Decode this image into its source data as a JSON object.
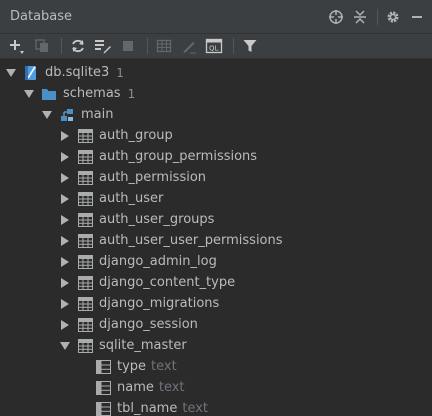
{
  "panel": {
    "title": "Database"
  },
  "title_tools": [
    {
      "name": "crosshair-icon"
    },
    {
      "name": "collapse-icon"
    },
    {
      "name": "gear-icon"
    },
    {
      "name": "hide-icon"
    }
  ],
  "toolbar": {
    "buttons": [
      {
        "name": "add-icon",
        "enabled": true
      },
      {
        "name": "duplicate-icon",
        "enabled": false
      },
      {
        "name": "refresh-icon",
        "enabled": true
      },
      {
        "name": "properties-icon",
        "enabled": true
      },
      {
        "name": "stop-icon",
        "enabled": false
      },
      {
        "name": "table-editor-icon",
        "enabled": false
      },
      {
        "name": "edit-icon",
        "enabled": false
      },
      {
        "name": "sql-console-icon",
        "enabled": true
      },
      {
        "name": "filter-icon",
        "enabled": true
      }
    ],
    "sql_label": "QL"
  },
  "tree": {
    "db": {
      "label": "db.sqlite3",
      "count": "1"
    },
    "schemas": {
      "label": "schemas",
      "count": "1"
    },
    "main": {
      "label": "main"
    },
    "tables": [
      "auth_group",
      "auth_group_permissions",
      "auth_permission",
      "auth_user",
      "auth_user_groups",
      "auth_user_user_permissions",
      "django_admin_log",
      "django_content_type",
      "django_migrations",
      "django_session",
      "sqlite_master"
    ],
    "columns": [
      {
        "name": "type",
        "type": "text"
      },
      {
        "name": "name",
        "type": "text"
      },
      {
        "name": "tbl_name",
        "type": "text"
      }
    ]
  },
  "colors": {
    "background": "#2b2b2b",
    "panel": "#3c3f41",
    "text": "#bbbbbb",
    "folder": "#4a8fc5",
    "db_accent": "#4e9de0"
  }
}
